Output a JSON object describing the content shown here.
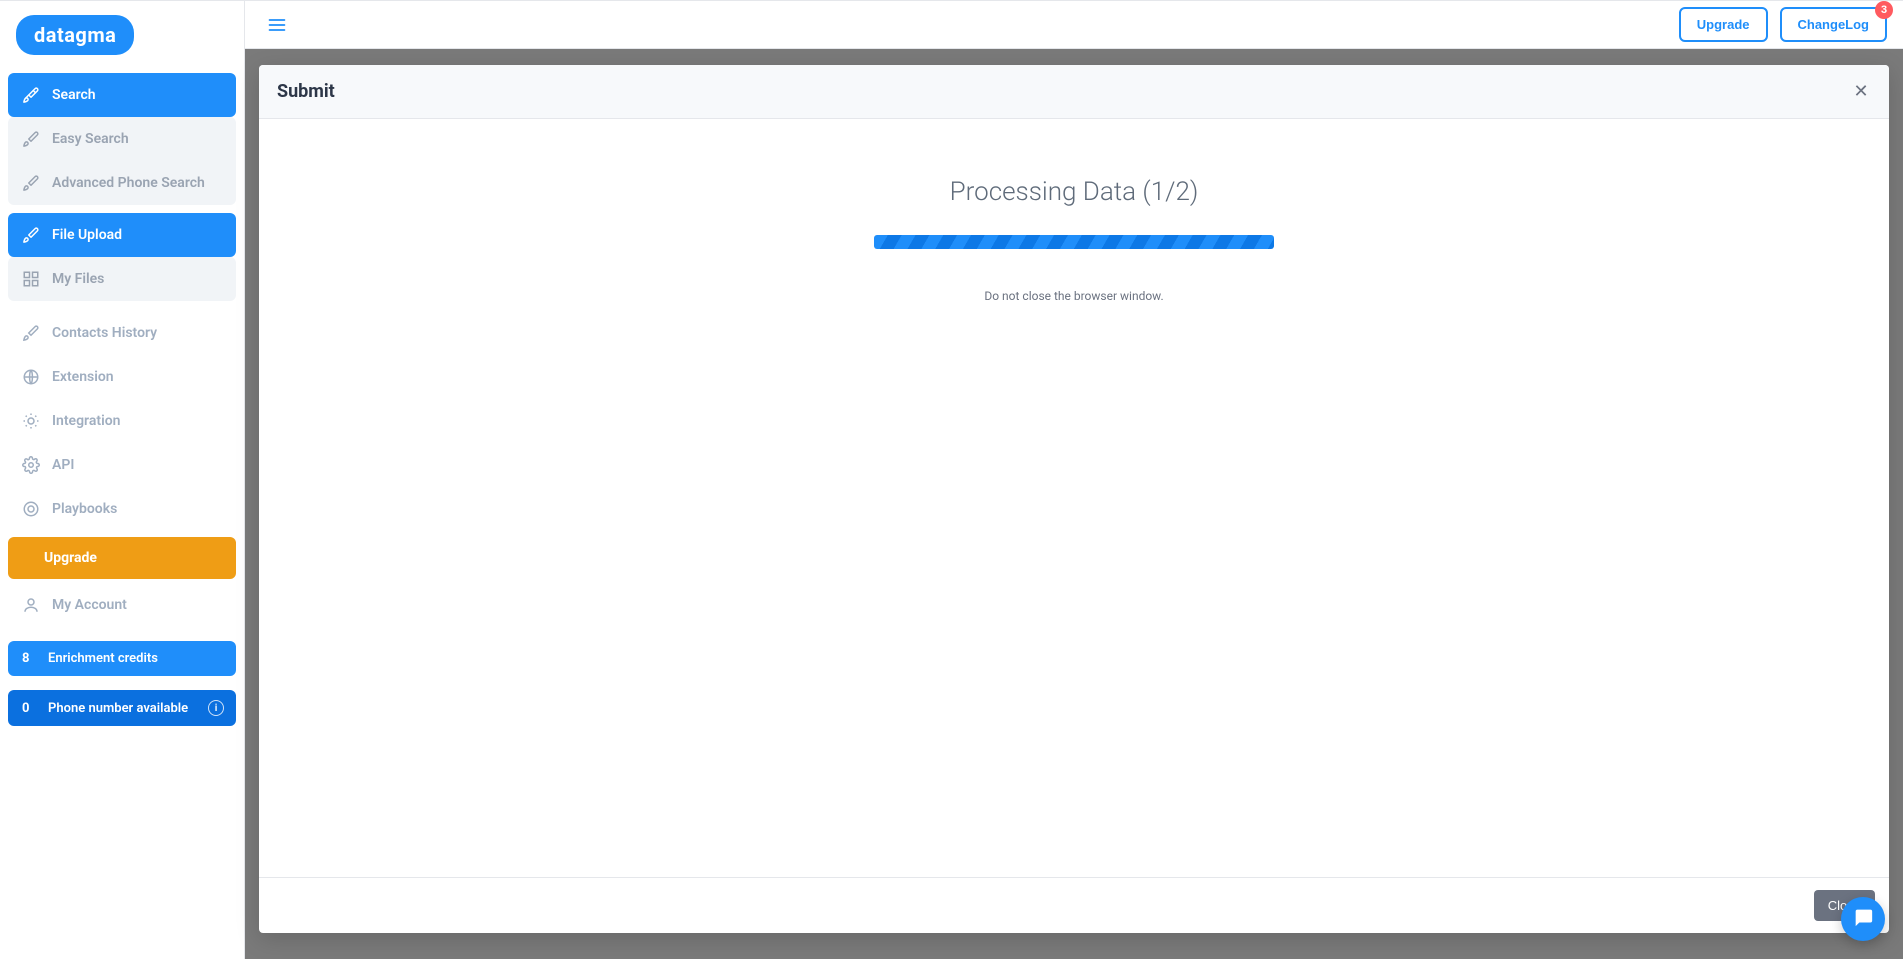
{
  "brand": {
    "name": "datagma"
  },
  "header": {
    "upgrade_label": "Upgrade",
    "changelog_label": "ChangeLog",
    "changelog_badge": "3"
  },
  "sidebar": {
    "items": [
      {
        "label": "Search"
      },
      {
        "label": "Easy Search"
      },
      {
        "label": "Advanced Phone Search"
      },
      {
        "label": "File Upload"
      },
      {
        "label": "My Files"
      },
      {
        "label": "Contacts History"
      },
      {
        "label": "Extension"
      },
      {
        "label": "Integration"
      },
      {
        "label": "API"
      },
      {
        "label": "Playbooks"
      },
      {
        "label": "Upgrade"
      },
      {
        "label": "My Account"
      }
    ],
    "enrichment": {
      "count": "8",
      "label": "Enrichment credits"
    },
    "phone": {
      "count": "0",
      "label": "Phone number available"
    }
  },
  "modal": {
    "title": "Submit",
    "processing_title": "Processing Data (1/2)",
    "note": "Do not close the browser window.",
    "close_label": "Close"
  }
}
